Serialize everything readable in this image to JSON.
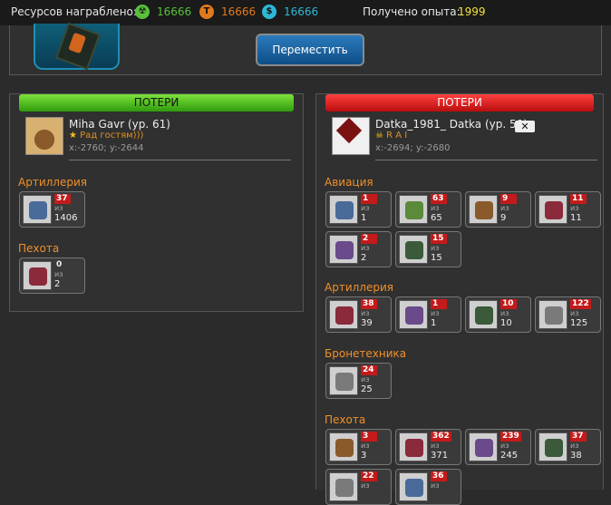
{
  "topbar": {
    "resources_label": "Ресурсов награблено:",
    "res1": "16666",
    "res1_color": "#59c03b",
    "res2": "16666",
    "res2_color": "#e07a1c",
    "res3": "16666",
    "res3_color": "#2eb8d8",
    "exp_label": "Получено опыта:",
    "exp_value": "1999"
  },
  "move_button": "Переместить",
  "left": {
    "title": "ПОТЕРИ",
    "player_name": "Miha Gavr (ур. 61)",
    "guild": "Рад гостям)))",
    "coords": "x:-2760; y:-2644",
    "sections": [
      {
        "name": "Артиллерия",
        "units": [
          {
            "lost": "37",
            "iz": "из",
            "total": "1406"
          }
        ]
      },
      {
        "name": "Пехота",
        "units": [
          {
            "lost": "0",
            "iz": "из",
            "total": "2"
          }
        ]
      }
    ]
  },
  "right": {
    "title": "ПОТЕРИ",
    "player_name": "Datka_1981_ Datka (ур. 50)",
    "guild": "R A I",
    "coords": "x:-2694; y:-2680",
    "close": "✕",
    "sections": [
      {
        "name": "Авиация",
        "units": [
          {
            "lost": "1",
            "iz": "из",
            "total": "1"
          },
          {
            "lost": "63",
            "iz": "из",
            "total": "65"
          },
          {
            "lost": "9",
            "iz": "из",
            "total": "9"
          },
          {
            "lost": "11",
            "iz": "из",
            "total": "11"
          },
          {
            "lost": "2",
            "iz": "из",
            "total": "2"
          },
          {
            "lost": "15",
            "iz": "из",
            "total": "15"
          }
        ]
      },
      {
        "name": "Артиллерия",
        "units": [
          {
            "lost": "38",
            "iz": "из",
            "total": "39"
          },
          {
            "lost": "1",
            "iz": "из",
            "total": "1"
          },
          {
            "lost": "10",
            "iz": "из",
            "total": "10"
          },
          {
            "lost": "122",
            "iz": "из",
            "total": "125"
          }
        ]
      },
      {
        "name": "Бронетехника",
        "units": [
          {
            "lost": "24",
            "iz": "из",
            "total": "25"
          }
        ]
      },
      {
        "name": "Пехота",
        "units": [
          {
            "lost": "3",
            "iz": "из",
            "total": "3"
          },
          {
            "lost": "362",
            "iz": "из",
            "total": "371"
          },
          {
            "lost": "239",
            "iz": "из",
            "total": "245"
          },
          {
            "lost": "37",
            "iz": "из",
            "total": "38"
          },
          {
            "lost": "22",
            "iz": "из",
            "total": ""
          },
          {
            "lost": "36",
            "iz": "из",
            "total": ""
          }
        ]
      }
    ]
  }
}
